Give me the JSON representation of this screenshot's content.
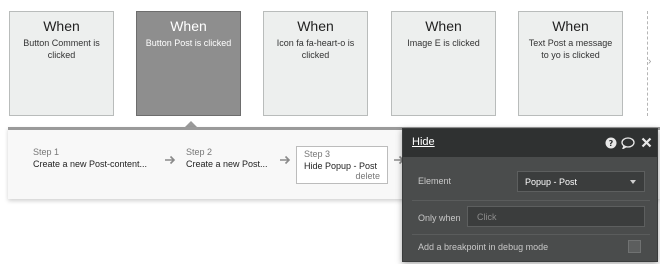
{
  "events": [
    {
      "when": "When",
      "description": "Button Comment is clicked",
      "selected": false
    },
    {
      "when": "When",
      "description": "Button Post is clicked",
      "selected": true
    },
    {
      "when": "When",
      "description": "Icon fa fa-heart-o is clicked",
      "selected": false
    },
    {
      "when": "When",
      "description": "Image E is clicked",
      "selected": false
    },
    {
      "when": "When",
      "description": "Text Post a message to yo is clicked",
      "selected": false
    }
  ],
  "steps": [
    {
      "number": "Step 1",
      "title": "Create a new Post-content..."
    },
    {
      "number": "Step 2",
      "title": "Create a new Post..."
    },
    {
      "number": "Step 3",
      "title": "Hide Popup - Post",
      "delete_label": "delete"
    }
  ],
  "popup": {
    "title": "Hide",
    "element_label": "Element",
    "element_value": "Popup - Post",
    "only_when_label": "Only when",
    "only_when_placeholder": "Click",
    "breakpoint_label": "Add a breakpoint in debug mode",
    "breakpoint_checked": false
  },
  "icons": {
    "help": "help-circle-icon",
    "comment": "comment-icon",
    "close": "close-icon",
    "step_arrow": "arrow-right-icon",
    "scroll": "chevron-right-icon"
  },
  "colors": {
    "selected_card": "#8e8e8e",
    "popup_bg": "#4a4c4c",
    "popup_header": "#2f3131"
  }
}
